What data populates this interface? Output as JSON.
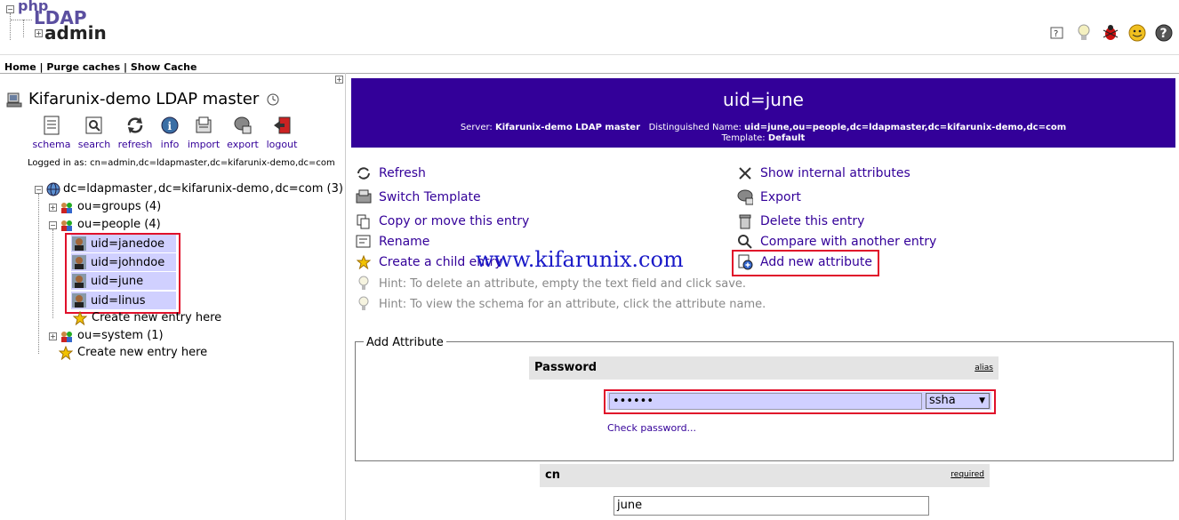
{
  "logo": {
    "php": "php",
    "ldap": "LDAP",
    "admin": "admin"
  },
  "topnav": {
    "home": "Home",
    "sep1": " | ",
    "purge": "Purge caches",
    "sep2": " | ",
    "cache": "Show Cache"
  },
  "left": {
    "server_title": "Kifarunix-demo LDAP master",
    "toolbar": [
      "schema",
      "search",
      "refresh",
      "info",
      "import",
      "export",
      "logout"
    ],
    "logged_in": "Logged in as: cn=admin,dc=ldapmaster,dc=kifarunix-demo,dc=com",
    "tree": {
      "root": "dc=ldapmaster , dc=kifarunix-demo , dc=com (3)",
      "groups": "ou=groups (4)",
      "people": "ou=people (4)",
      "users": [
        "uid=janedoe",
        "uid=johndoe",
        "uid=june",
        "uid=linus"
      ],
      "create_people": "Create new entry here",
      "system": "ou=system (1)",
      "create_root": "Create new entry here"
    }
  },
  "banner": {
    "title": "uid=june",
    "server_label": "Server: ",
    "server": "Kifarunix-demo LDAP master",
    "dn_label": "Distinguished Name: ",
    "dn": "uid=june,ou=people,dc=ldapmaster,dc=kifarunix-demo,dc=com",
    "template_label": "Template: ",
    "template": "Default"
  },
  "actions_left": [
    "Refresh",
    "Switch Template",
    "Copy or move this entry",
    "Rename",
    "Create a child entry"
  ],
  "actions_right": [
    "Show internal attributes",
    "Export",
    "Delete this entry",
    "Compare with another entry",
    "Add new attribute"
  ],
  "hints": [
    "Hint: To delete an attribute, empty the text field and click save.",
    "Hint: To view the schema for an attribute, click the attribute name."
  ],
  "watermark": "www.kifarunix.com",
  "add_attr": {
    "legend": "Add Attribute",
    "password": {
      "label": "Password",
      "tag": "alias",
      "value": "••••••",
      "hash": "ssha",
      "check": "Check password..."
    },
    "cn": {
      "label": "cn",
      "tag": "required",
      "value": "june"
    }
  },
  "colors": {
    "header_bg": "#330099",
    "link": "#330099",
    "highlight": "#d0d0ff",
    "callout": "#e0102a"
  }
}
